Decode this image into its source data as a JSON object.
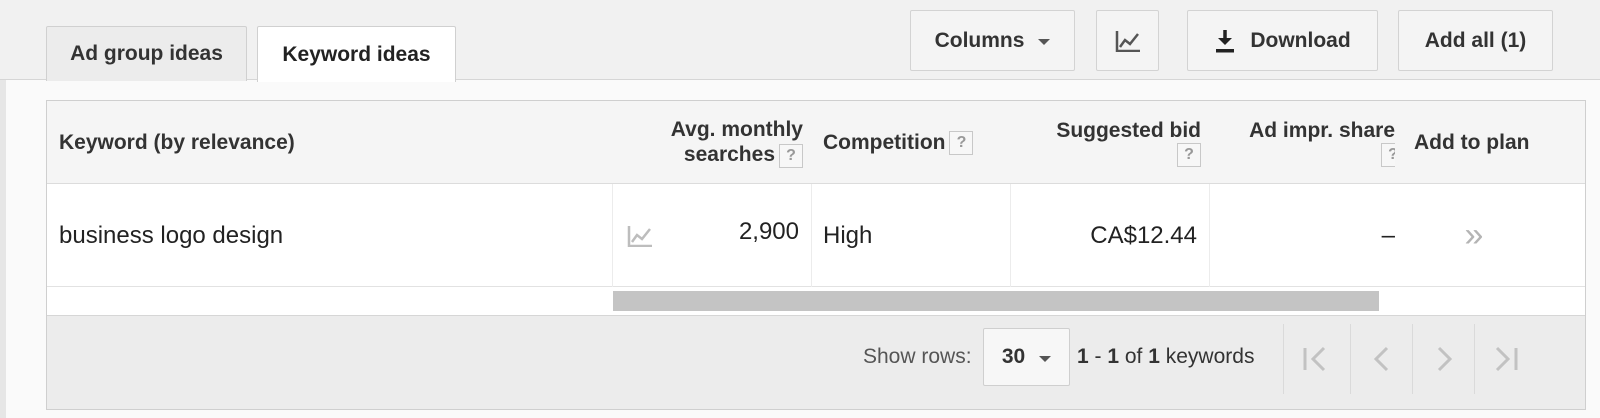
{
  "tabs": [
    {
      "label": "Ad group ideas",
      "active": false
    },
    {
      "label": "Keyword ideas",
      "active": true
    }
  ],
  "toolbar": {
    "columns_label": "Columns",
    "download_label": "Download",
    "add_all_label": "Add all (1)"
  },
  "table": {
    "headers": {
      "keyword": "Keyword (by relevance)",
      "avg_line1": "Avg. monthly",
      "avg_line2": "searches",
      "competition": "Competition",
      "bid": "Suggested bid",
      "impr": "Ad impr. share",
      "add": "Add to plan",
      "help": "?"
    },
    "rows": [
      {
        "keyword": "business logo design",
        "avg_monthly_searches": "2,900",
        "competition": "High",
        "suggested_bid": "CA$12.44",
        "ad_impr_share": "–",
        "add_to_plan": "»"
      }
    ]
  },
  "footer": {
    "show_rows_label": "Show rows:",
    "rows_value": "30",
    "range_start": "1",
    "range_sep": " - ",
    "range_end": "1",
    "range_of": " of ",
    "total": "1",
    "range_suffix": " keywords"
  },
  "colors": {
    "header_bg": "#f5f5f5",
    "footer_bg": "#ececec",
    "scrollbar": "#c4c4c4",
    "icon_gray": "#bdbdbd"
  }
}
